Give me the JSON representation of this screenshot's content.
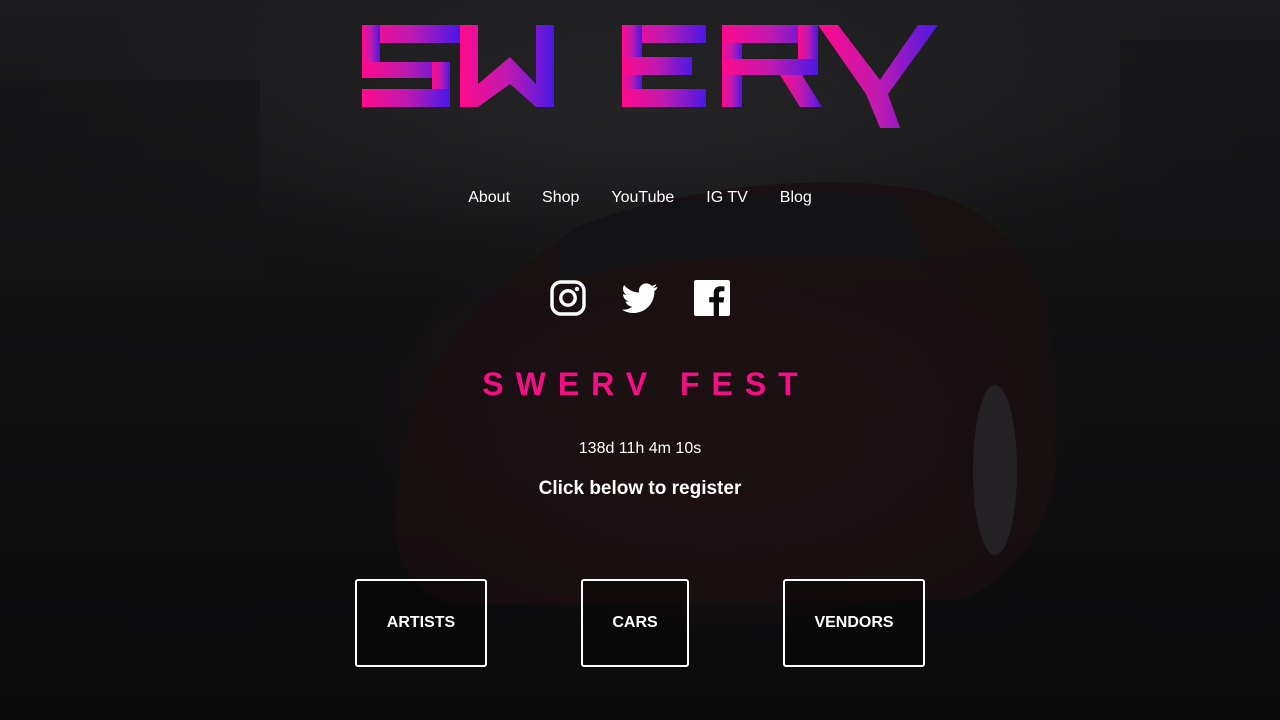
{
  "brand": {
    "logo_text": "SWERV",
    "gradient": [
      "#ff0a8c",
      "#c01ab0",
      "#4a18e6"
    ]
  },
  "nav": {
    "items": [
      {
        "label": "About"
      },
      {
        "label": "Shop"
      },
      {
        "label": "YouTube"
      },
      {
        "label": "IG TV"
      },
      {
        "label": "Blog"
      }
    ]
  },
  "socials": [
    {
      "icon": "instagram-icon"
    },
    {
      "icon": "twitter-icon"
    },
    {
      "icon": "facebook-icon"
    }
  ],
  "event": {
    "title": "SWERV FEST",
    "title_color": "#f40f86",
    "countdown": "138d 11h 4m 10s",
    "register_prompt": "Click below to register"
  },
  "registration": {
    "buttons": [
      {
        "label": "ARTISTS"
      },
      {
        "label": "CARS"
      },
      {
        "label": "VENDORS"
      }
    ]
  }
}
